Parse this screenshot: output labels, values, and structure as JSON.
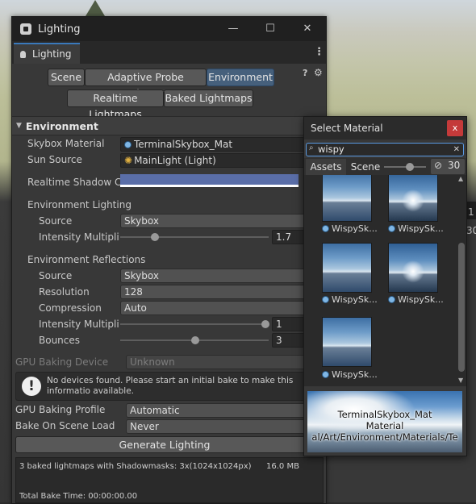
{
  "window": {
    "title": "Lighting",
    "tab_label": "Lighting",
    "controls": {
      "minimize": "—",
      "maximize": "☐",
      "close": "✕"
    },
    "menu": "⋮"
  },
  "toolbar": {
    "tabs": [
      "Scene",
      "Adaptive Probe Volumes",
      "Environment"
    ],
    "active_tab": "Environment",
    "tabs_row2": [
      "Realtime Lightmaps",
      "Baked Lightmaps"
    ],
    "help_icon": "?",
    "settings_icon": "⚙"
  },
  "environment": {
    "section_title": "Environment",
    "skybox_material_label": "Skybox Material",
    "skybox_material_value": "TerminalSkybox_Mat",
    "sun_source_label": "Sun Source",
    "sun_source_value": "MainLight (Light)",
    "realtime_shadow_label": "Realtime Shadow Co",
    "realtime_shadow_color": "#5a6ea8",
    "env_lighting_header": "Environment Lighting",
    "lighting_source_label": "Source",
    "lighting_source_value": "Skybox",
    "intensity_label": "Intensity Multiplie",
    "intensity_value": "1.7",
    "intensity_level": 0.22,
    "env_reflections_header": "Environment Reflections",
    "refl_source_label": "Source",
    "refl_source_value": "Skybox",
    "resolution_label": "Resolution",
    "resolution_value": "128",
    "compression_label": "Compression",
    "compression_value": "Auto",
    "refl_intensity_label": "Intensity Multiplie",
    "refl_intensity_value": "1",
    "bounces_label": "Bounces",
    "bounces_value": "3"
  },
  "baking": {
    "gpu_device_label": "GPU Baking Device",
    "gpu_device_value": "Unknown",
    "help_message": "No devices found. Please start an initial bake to make this informatio available.",
    "gpu_profile_label": "GPU Baking Profile",
    "gpu_profile_value": "Automatic",
    "bake_on_load_label": "Bake On Scene Load",
    "bake_on_load_value": "Never",
    "generate_button": "Generate Lighting",
    "stats_line": "3 baked lightmaps with Shadowmasks: 3x(1024x1024px)",
    "stats_size": "16.0 MB",
    "total_bake_time": "Total Bake Time: 00:00:00.00"
  },
  "picker": {
    "title": "Select Material",
    "close": "x",
    "search_value": "wispy",
    "search_clear": "✕",
    "tab_assets": "Assets",
    "tab_scene": "Scene",
    "hidden_count": "30",
    "items": [
      "WispySk...",
      "WispySk...",
      "WispySk...",
      "WispySk...",
      "WispySk..."
    ],
    "preview_name": "TerminalSkybox_Mat",
    "preview_type": "Material",
    "preview_path": "al/Art/Environment/Materials/Te"
  },
  "background": {
    "right_label_a": "1",
    "right_label_b": "30"
  }
}
